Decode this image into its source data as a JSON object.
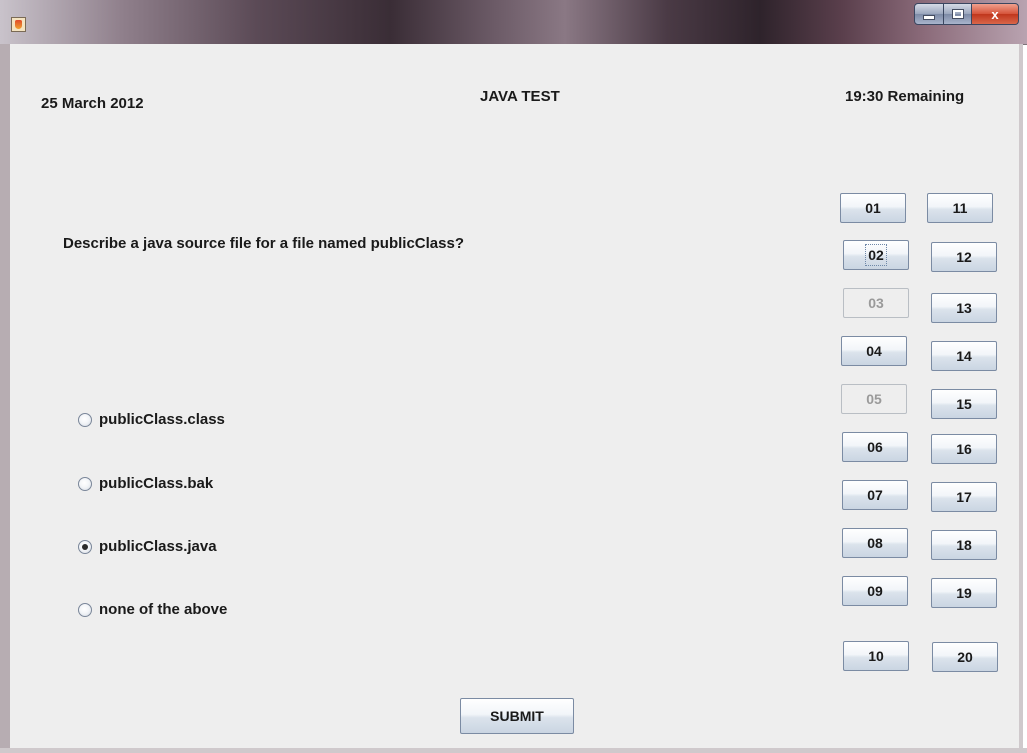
{
  "window": {
    "title": "",
    "icon": "java-cup-icon",
    "controls": {
      "minimize_icon": "minimize-icon",
      "maximize_icon": "maximize-icon",
      "close_icon": "close-icon",
      "close_label": "x"
    }
  },
  "header": {
    "date": "25 March 2012",
    "title": "JAVA TEST",
    "timer": "19:30 Remaining"
  },
  "question": {
    "text": "Describe a java source file for a file named publicClass?",
    "options": [
      {
        "label": "publicClass.class",
        "selected": false
      },
      {
        "label": "publicClass.bak",
        "selected": false
      },
      {
        "label": "publicClass.java",
        "selected": true
      },
      {
        "label": "none of the above",
        "selected": false
      }
    ]
  },
  "navigator": {
    "buttons": [
      {
        "label": "01",
        "state": "normal"
      },
      {
        "label": "02",
        "state": "focused"
      },
      {
        "label": "03",
        "state": "disabled"
      },
      {
        "label": "04",
        "state": "normal"
      },
      {
        "label": "05",
        "state": "disabled"
      },
      {
        "label": "06",
        "state": "normal"
      },
      {
        "label": "07",
        "state": "normal"
      },
      {
        "label": "08",
        "state": "normal"
      },
      {
        "label": "09",
        "state": "normal"
      },
      {
        "label": "10",
        "state": "normal"
      },
      {
        "label": "11",
        "state": "normal"
      },
      {
        "label": "12",
        "state": "normal"
      },
      {
        "label": "13",
        "state": "normal"
      },
      {
        "label": "14",
        "state": "normal"
      },
      {
        "label": "15",
        "state": "normal"
      },
      {
        "label": "16",
        "state": "normal"
      },
      {
        "label": "17",
        "state": "normal"
      },
      {
        "label": "18",
        "state": "normal"
      },
      {
        "label": "19",
        "state": "normal"
      },
      {
        "label": "20",
        "state": "normal"
      }
    ]
  },
  "actions": {
    "submit_label": "SUBMIT"
  },
  "colors": {
    "frame_background": "#eeeeee",
    "button_border": "#7b8ba3",
    "close_button": "#d5533a"
  }
}
